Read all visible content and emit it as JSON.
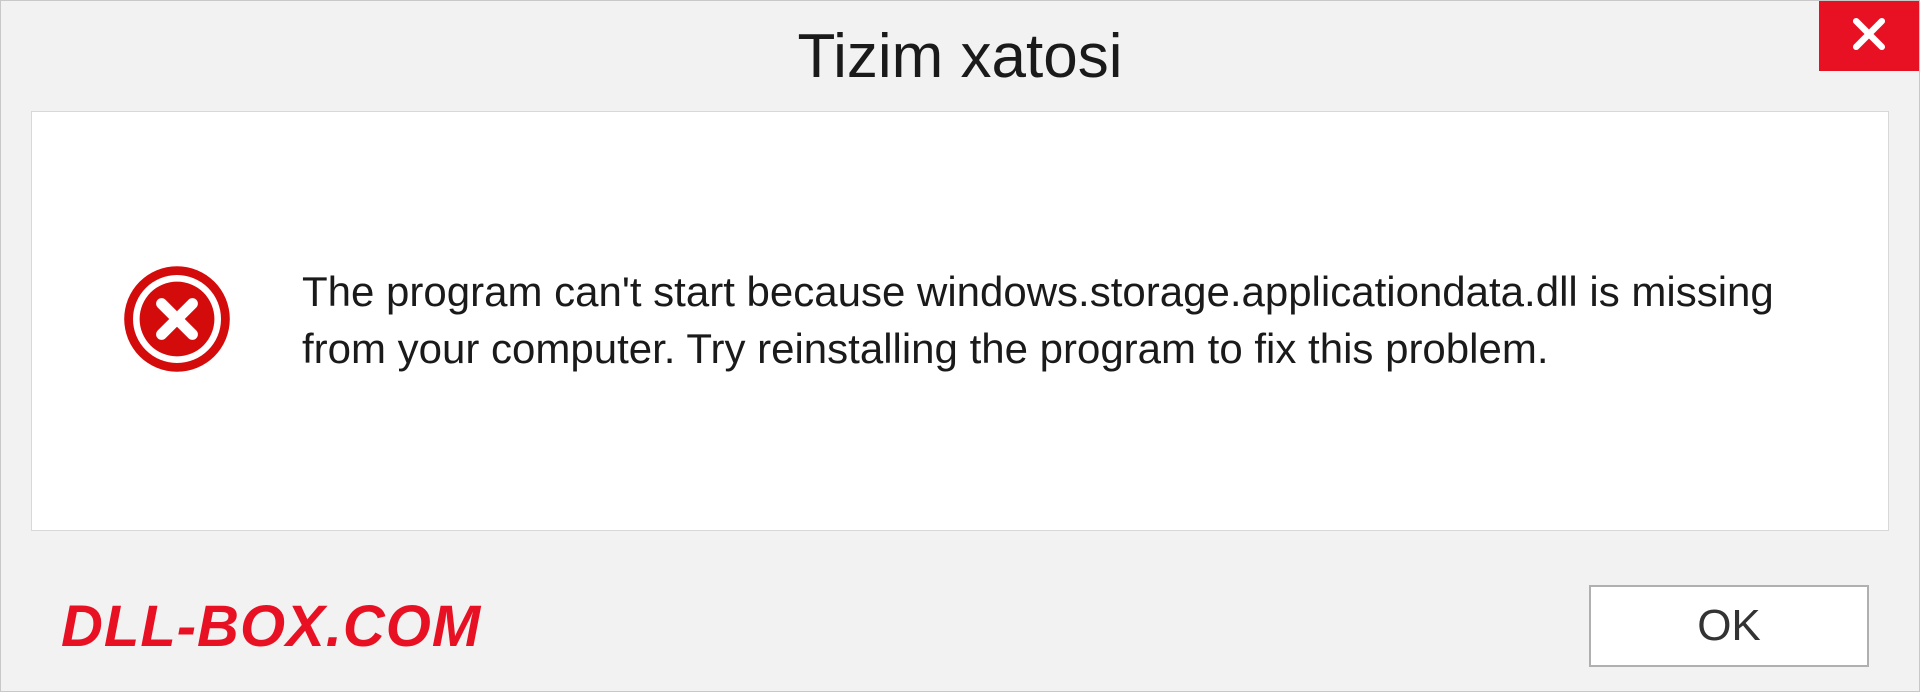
{
  "dialog": {
    "title": "Tizim xatosi",
    "message": "The program can't start because windows.storage.applicationdata.dll is missing from your computer. Try reinstalling the program to fix this problem.",
    "ok_label": "OK",
    "watermark": "DLL-BOX.COM"
  }
}
